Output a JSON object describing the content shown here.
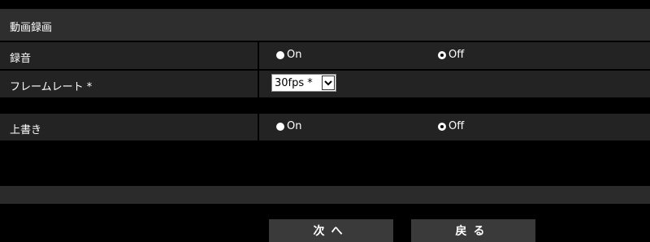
{
  "section": {
    "title": "動画録画"
  },
  "rows": {
    "audio": {
      "label": "録音",
      "on_label": "On",
      "off_label": "Off",
      "selected": "Off"
    },
    "framerate": {
      "label": "フレームレート *",
      "value": "30fps *"
    },
    "overwrite": {
      "label": "上書き",
      "on_label": "On",
      "off_label": "Off",
      "selected": "Off"
    }
  },
  "buttons": {
    "next": "次へ",
    "back": "戻る"
  },
  "icons": {
    "dropdown": "chevron-down-icon"
  },
  "colors": {
    "background": "#000000",
    "row_bg": "#232323",
    "title_bg": "#2e2e2e",
    "button_bg": "#3a3a3a"
  }
}
